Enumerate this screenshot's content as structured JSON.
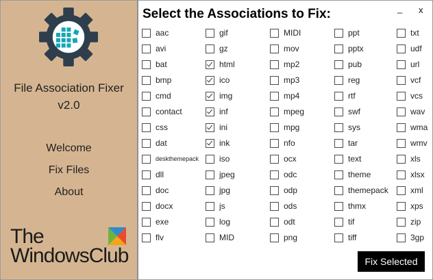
{
  "sidebar": {
    "app_name": "File Association Fixer",
    "version": "v2.0",
    "nav": [
      "Welcome",
      "Fix Files",
      "About"
    ],
    "brand": "The Windows Club"
  },
  "window": {
    "minimize_label": "_",
    "close_label": "x"
  },
  "main": {
    "heading": "Select the Associations to Fix:",
    "fix_button_label": "Fix Selected",
    "columns": [
      [
        {
          "ext": "aac",
          "checked": false
        },
        {
          "ext": "avi",
          "checked": false
        },
        {
          "ext": "bat",
          "checked": false
        },
        {
          "ext": "bmp",
          "checked": false
        },
        {
          "ext": "cmd",
          "checked": false
        },
        {
          "ext": "contact",
          "checked": false
        },
        {
          "ext": "css",
          "checked": false
        },
        {
          "ext": "dat",
          "checked": false
        },
        {
          "ext": "deskthemepack",
          "checked": false
        },
        {
          "ext": "dll",
          "checked": false
        },
        {
          "ext": "doc",
          "checked": false
        },
        {
          "ext": "docx",
          "checked": false
        },
        {
          "ext": "exe",
          "checked": false
        },
        {
          "ext": "flv",
          "checked": false
        }
      ],
      [
        {
          "ext": "gif",
          "checked": false
        },
        {
          "ext": "gz",
          "checked": false
        },
        {
          "ext": "html",
          "checked": true
        },
        {
          "ext": "ico",
          "checked": true
        },
        {
          "ext": "img",
          "checked": true
        },
        {
          "ext": "inf",
          "checked": true
        },
        {
          "ext": "ini",
          "checked": true
        },
        {
          "ext": "ink",
          "checked": true
        },
        {
          "ext": "iso",
          "checked": false
        },
        {
          "ext": "jpeg",
          "checked": false
        },
        {
          "ext": "jpg",
          "checked": false
        },
        {
          "ext": "js",
          "checked": false
        },
        {
          "ext": "log",
          "checked": false
        },
        {
          "ext": "MID",
          "checked": false
        }
      ],
      [
        {
          "ext": "MIDI",
          "checked": false
        },
        {
          "ext": "mov",
          "checked": false
        },
        {
          "ext": "mp2",
          "checked": false
        },
        {
          "ext": "mp3",
          "checked": false
        },
        {
          "ext": "mp4",
          "checked": false
        },
        {
          "ext": "mpeg",
          "checked": false
        },
        {
          "ext": "mpg",
          "checked": false
        },
        {
          "ext": "nfo",
          "checked": false
        },
        {
          "ext": "ocx",
          "checked": false
        },
        {
          "ext": "odc",
          "checked": false
        },
        {
          "ext": "odp",
          "checked": false
        },
        {
          "ext": "ods",
          "checked": false
        },
        {
          "ext": "odt",
          "checked": false
        },
        {
          "ext": "png",
          "checked": false
        }
      ],
      [
        {
          "ext": "ppt",
          "checked": false
        },
        {
          "ext": "pptx",
          "checked": false
        },
        {
          "ext": "pub",
          "checked": false
        },
        {
          "ext": "reg",
          "checked": false
        },
        {
          "ext": "rtf",
          "checked": false
        },
        {
          "ext": "swf",
          "checked": false
        },
        {
          "ext": "sys",
          "checked": false
        },
        {
          "ext": "tar",
          "checked": false
        },
        {
          "ext": "text",
          "checked": false
        },
        {
          "ext": "theme",
          "checked": false
        },
        {
          "ext": "themepack",
          "checked": false
        },
        {
          "ext": "thmx",
          "checked": false
        },
        {
          "ext": "tif",
          "checked": false
        },
        {
          "ext": "tiff",
          "checked": false
        }
      ],
      [
        {
          "ext": "txt",
          "checked": false
        },
        {
          "ext": "udf",
          "checked": false
        },
        {
          "ext": "url",
          "checked": false
        },
        {
          "ext": "vcf",
          "checked": false
        },
        {
          "ext": "vcs",
          "checked": false
        },
        {
          "ext": "wav",
          "checked": false
        },
        {
          "ext": "wma",
          "checked": false
        },
        {
          "ext": "wmv",
          "checked": false
        },
        {
          "ext": "xls",
          "checked": false
        },
        {
          "ext": "xlsx",
          "checked": false
        },
        {
          "ext": "xml",
          "checked": false
        },
        {
          "ext": "xps",
          "checked": false
        },
        {
          "ext": "zip",
          "checked": false
        },
        {
          "ext": "3gp",
          "checked": false
        }
      ]
    ]
  },
  "colors": {
    "sidebar_bg": "#d5b591",
    "logo_dark": "#2f3e4c",
    "logo_accent": "#16a6b5",
    "button_bg": "#000000"
  },
  "icons": {
    "app_logo": "gear-with-grid-icon",
    "checkbox": "checkbox-icon"
  }
}
